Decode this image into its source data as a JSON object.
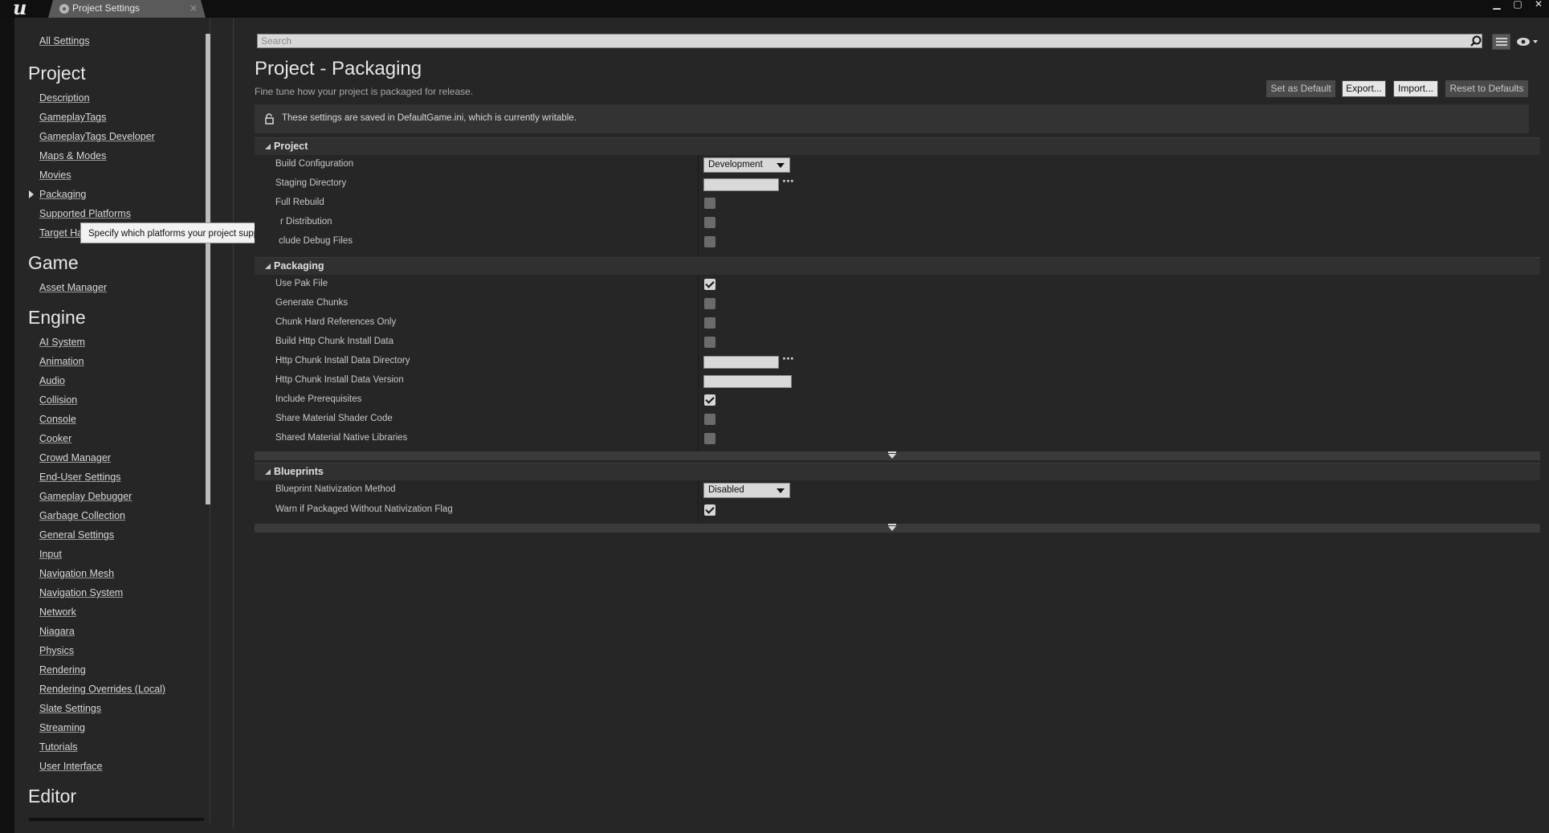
{
  "window": {
    "tab_title": "Project Settings",
    "controls": {
      "minimize": "▁",
      "maximize": "▢",
      "close": "✕"
    }
  },
  "sidebar": {
    "all_settings": "All Settings",
    "sections": [
      {
        "header": "Project",
        "items": [
          "Description",
          "GameplayTags",
          "GameplayTags Developer",
          "Maps & Modes",
          "Movies",
          "Packaging",
          "Supported Platforms",
          "Target Hardware"
        ]
      },
      {
        "header": "Game",
        "items": [
          "Asset Manager"
        ]
      },
      {
        "header": "Engine",
        "items": [
          "AI System",
          "Animation",
          "Audio",
          "Collision",
          "Console",
          "Cooker",
          "Crowd Manager",
          "End-User Settings",
          "Gameplay Debugger",
          "Garbage Collection",
          "General Settings",
          "Input",
          "Navigation Mesh",
          "Navigation System",
          "Network",
          "Niagara",
          "Physics",
          "Rendering",
          "Rendering Overrides (Local)",
          "Slate Settings",
          "Streaming",
          "Tutorials",
          "User Interface"
        ]
      },
      {
        "header": "Editor",
        "items": []
      }
    ],
    "active_item": "Packaging",
    "tooltip": "Specify which platforms your project supports."
  },
  "search": {
    "placeholder": "Search",
    "value": ""
  },
  "main": {
    "title": "Project - Packaging",
    "subtitle": "Fine tune how your project is packaged for release.",
    "buttons": {
      "set_default": "Set as Default",
      "export": "Export...",
      "import": "Import...",
      "reset": "Reset to Defaults"
    },
    "notice": "These settings are saved in DefaultGame.ini, which is currently writable."
  },
  "sections": {
    "project": {
      "title": "Project",
      "rows": {
        "build_configuration": {
          "label": "Build Configuration",
          "value": "Development"
        },
        "staging_directory": {
          "label": "Staging Directory",
          "value": ""
        },
        "full_rebuild": {
          "label": "Full Rebuild",
          "checked": false
        },
        "for_distribution": {
          "label": "r Distribution",
          "checked": false
        },
        "include_debug_files": {
          "label": "clude Debug Files",
          "checked": false
        }
      }
    },
    "packaging": {
      "title": "Packaging",
      "rows": {
        "use_pak_file": {
          "label": "Use Pak File",
          "checked": true
        },
        "generate_chunks": {
          "label": "Generate Chunks",
          "checked": false
        },
        "chunk_hard_refs": {
          "label": "Chunk Hard References Only",
          "checked": false
        },
        "build_http_chunk": {
          "label": "Build Http Chunk Install Data",
          "checked": false
        },
        "http_chunk_dir": {
          "label": "Http Chunk Install Data Directory",
          "value": ""
        },
        "http_chunk_version": {
          "label": "Http Chunk Install Data Version",
          "value": ""
        },
        "include_prereqs": {
          "label": "Include Prerequisites",
          "checked": true
        },
        "share_material_shader": {
          "label": "Share Material Shader Code",
          "checked": false
        },
        "shared_material_native": {
          "label": "Shared Material Native Libraries",
          "checked": false
        }
      }
    },
    "blueprints": {
      "title": "Blueprints",
      "rows": {
        "nativization_method": {
          "label": "Blueprint Nativization Method",
          "value": "Disabled"
        },
        "warn_without_flag": {
          "label": "Warn if Packaged Without Nativization Flag",
          "checked": true
        }
      }
    }
  },
  "icons": {
    "logo": "unreal-logo",
    "search": "search-icon",
    "lock": "lock-icon",
    "eye": "eye-icon",
    "view_options": "view-options-icon"
  },
  "colors": {
    "background": "#262626",
    "section_header": "#303030",
    "titlebar": "#0f0f0f"
  }
}
